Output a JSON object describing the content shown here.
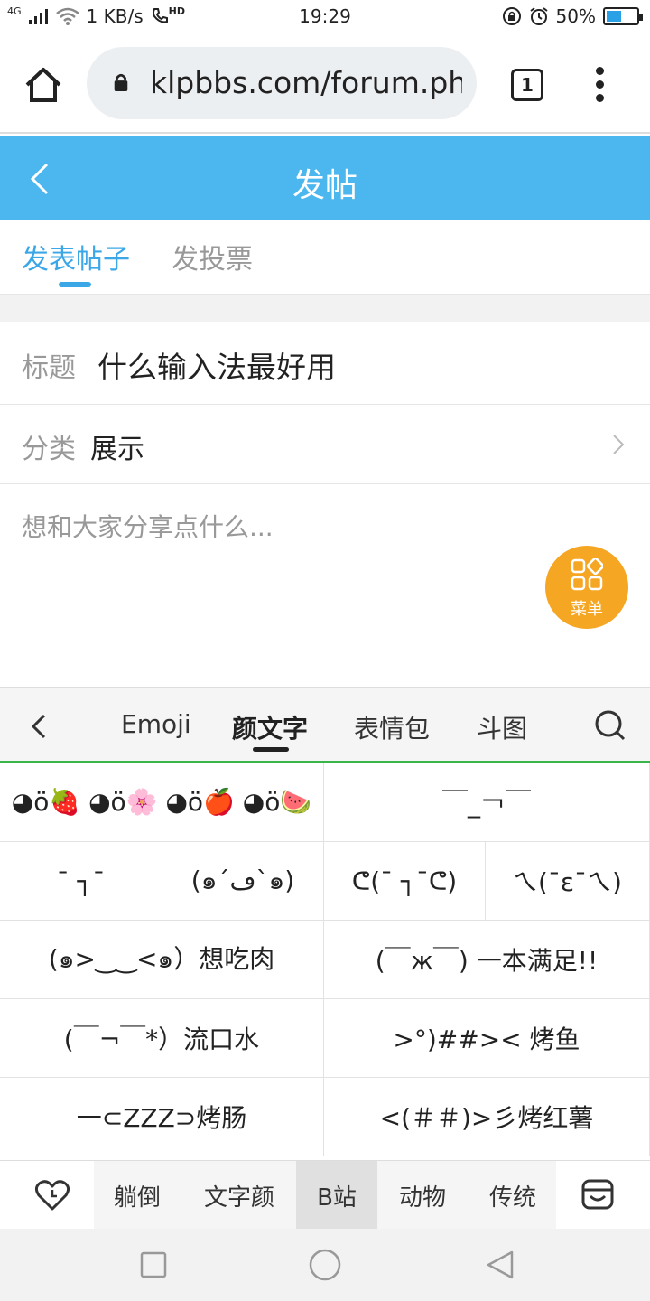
{
  "status_bar": {
    "network": "4G",
    "speed": "1 KB/s",
    "hd": "HD",
    "time": "19:29",
    "battery_text": "50%",
    "battery_level": 0.5
  },
  "browser": {
    "url": "klpbbs.com/forum.ph",
    "tab_count": "1"
  },
  "header": {
    "title": "发帖"
  },
  "post_tabs": {
    "active": "发表帖子",
    "inactive": "发投票"
  },
  "form": {
    "title_label": "标题",
    "title_value": "什么输入法最好用",
    "category_label": "分类",
    "category_value": "展示",
    "content_placeholder": "想和大家分享点什么..."
  },
  "fab": {
    "label": "菜单"
  },
  "keyboard": {
    "tabs": [
      "Emoji",
      "颜文字",
      "表情包",
      "斗图"
    ],
    "active_tab": 1,
    "emoticons": {
      "r1c1": "◕ö🍓 ◕ö🌸 ◕ö🍎 ◕ö🍉",
      "r1c2": "￣_￢￣",
      "r2c1": "¯ ┐¯",
      "r2c2": "(๑´ڡ`๑)",
      "r2c3": "ᕦ(¯ ┐¯ᕦ)",
      "r2c4": "ㄟ(¯ε¯ㄟ)",
      "r3c1": "(๑>‿‿<๑）想吃肉",
      "r3c2": "(￣ж￣) 一本满足!!",
      "r4c1": "(￣¬￣*）流口水",
      "r4c2": ">°)##><  烤鱼",
      "r5c1": "一⊂ZZZ⊃烤肠",
      "r5c2": "<(＃＃)>彡烤红薯"
    },
    "categories": [
      "躺倒",
      "文字颜",
      "B站",
      "动物",
      "传统"
    ],
    "selected_category": 2
  }
}
